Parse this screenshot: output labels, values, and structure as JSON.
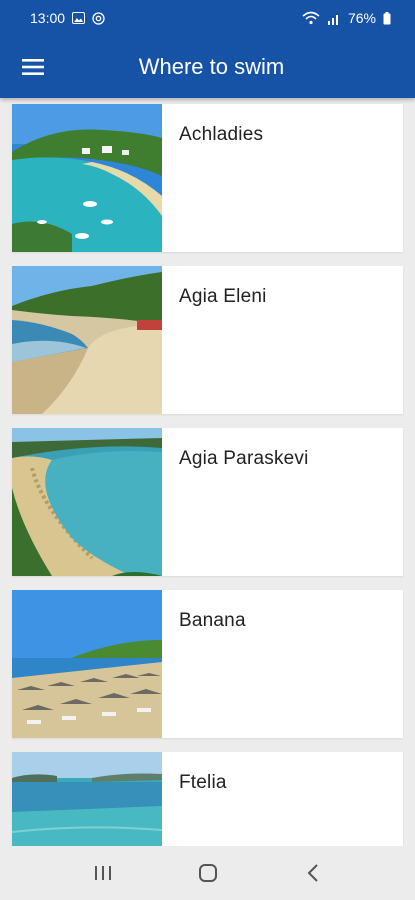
{
  "status_bar": {
    "time": "13:00",
    "battery": "76%",
    "icons": [
      "image-icon",
      "at-icon",
      "wifi-icon",
      "signal-icon",
      "battery-icon"
    ]
  },
  "app_bar": {
    "title": "Where to swim",
    "menu_icon": "hamburger-menu-icon",
    "background": "#1652a6"
  },
  "beaches": [
    {
      "name": "Achladies",
      "photo": "beach-photo"
    },
    {
      "name": "Agia Eleni",
      "photo": "beach-photo"
    },
    {
      "name": "Agia Paraskevi",
      "photo": "beach-photo"
    },
    {
      "name": "Banana",
      "photo": "beach-photo"
    },
    {
      "name": "Ftelia",
      "photo": "beach-photo"
    }
  ],
  "nav_bar": {
    "icons": [
      "recent-apps-icon",
      "home-icon",
      "back-icon"
    ]
  }
}
